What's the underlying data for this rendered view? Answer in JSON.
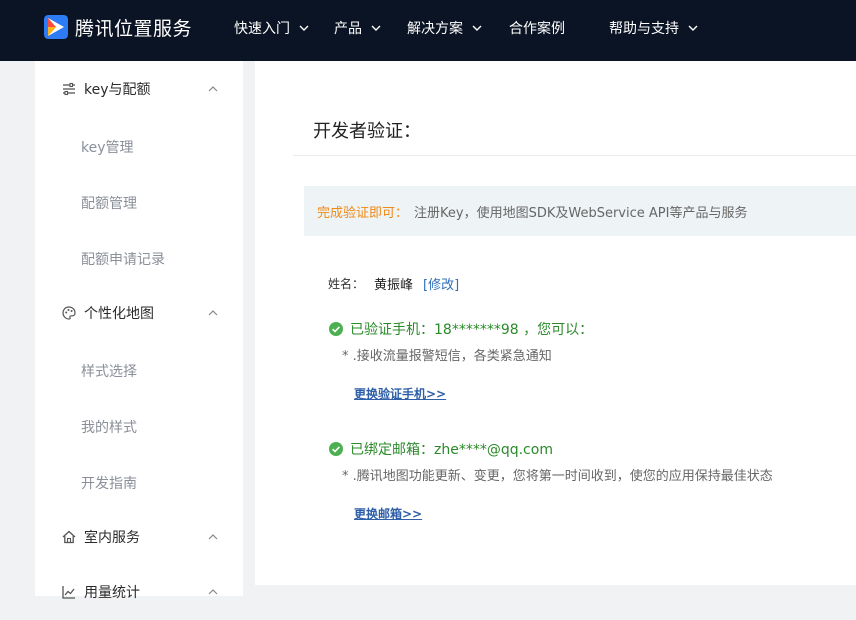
{
  "header": {
    "brand": "腾讯位置服务",
    "nav": [
      {
        "label": "快速入门",
        "has_dropdown": true
      },
      {
        "label": "产品",
        "has_dropdown": true
      },
      {
        "label": "解决方案",
        "has_dropdown": true
      },
      {
        "label": "合作案例",
        "has_dropdown": false
      },
      {
        "label": "帮助与支持",
        "has_dropdown": true
      }
    ]
  },
  "sidebar": {
    "groups": [
      {
        "label": "key与配额",
        "icon": "sliders-icon",
        "expanded": true,
        "items": [
          {
            "label": "key管理"
          },
          {
            "label": "配额管理"
          },
          {
            "label": "配额申请记录"
          }
        ]
      },
      {
        "label": "个性化地图",
        "icon": "palette-icon",
        "expanded": true,
        "items": [
          {
            "label": "样式选择"
          },
          {
            "label": "我的样式"
          },
          {
            "label": "开发指南"
          }
        ]
      },
      {
        "label": "室内服务",
        "icon": "home-icon",
        "expanded": true,
        "items": []
      },
      {
        "label": "用量统计",
        "icon": "chart-icon",
        "expanded": true,
        "items": []
      }
    ]
  },
  "main": {
    "title": "开发者验证：",
    "notice": {
      "highlight": "完成验证即可：",
      "text": "注册Key，使用地图SDK及WebService API等产品与服务"
    },
    "name": {
      "label": "姓名：",
      "value": "黄振峰",
      "edit_label": "[修改]"
    },
    "phone": {
      "status": "已验证手机：18*******98 ，您可以：",
      "note": "* .接收流量报警短信，各类紧急通知",
      "change_link": "更换验证手机>>"
    },
    "email": {
      "status": "已绑定邮箱：zhe****@qq.com",
      "note": "* .腾讯地图功能更新、变更，您将第一时间收到，使您的应用保持最佳状态",
      "change_link": "更换邮箱>>"
    }
  },
  "colors": {
    "header_bg": "#0b1424",
    "accent_orange": "#f08a16",
    "success_green": "#2a8a2a",
    "link_blue": "#2f5fa8"
  }
}
